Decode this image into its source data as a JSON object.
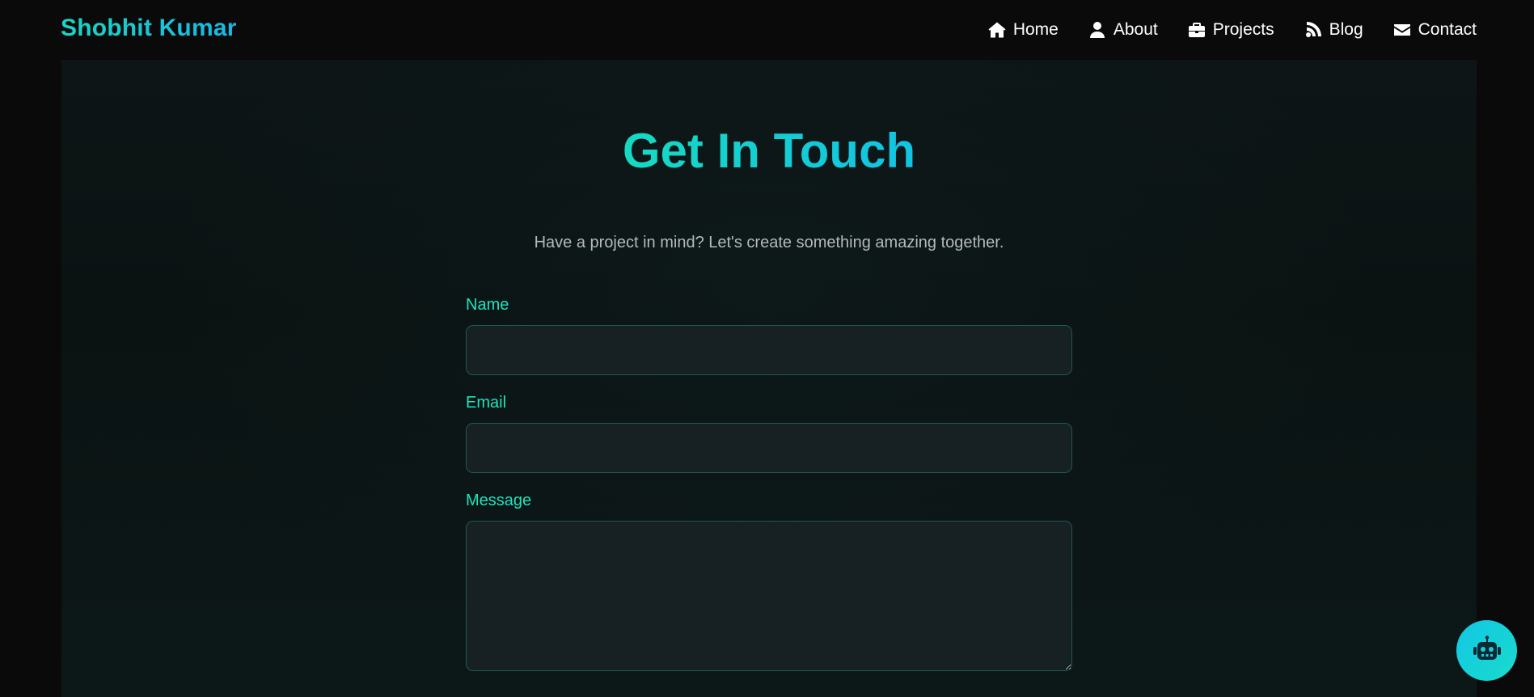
{
  "brand": {
    "name": "Shobhit Kumar"
  },
  "nav": {
    "items": [
      {
        "label": "Home",
        "icon": "home-icon"
      },
      {
        "label": "About",
        "icon": "user-icon"
      },
      {
        "label": "Projects",
        "icon": "briefcase-icon"
      },
      {
        "label": "Blog",
        "icon": "rss-icon"
      },
      {
        "label": "Contact",
        "icon": "envelope-icon"
      }
    ]
  },
  "contact": {
    "title": "Get In Touch",
    "subtitle": "Have a project in mind? Let's create something amazing together.",
    "fields": {
      "name_label": "Name",
      "name_value": "",
      "email_label": "Email",
      "email_value": "",
      "message_label": "Message",
      "message_value": ""
    }
  },
  "chat": {
    "icon": "robot-icon"
  },
  "colors": {
    "accent_teal": "#1fe3bd",
    "accent_cyan": "#12c3e3",
    "background": "#0a0a0a",
    "field_bg": "#172022",
    "field_border": "#1f5a51",
    "subtitle_text": "#b4b9ba"
  }
}
